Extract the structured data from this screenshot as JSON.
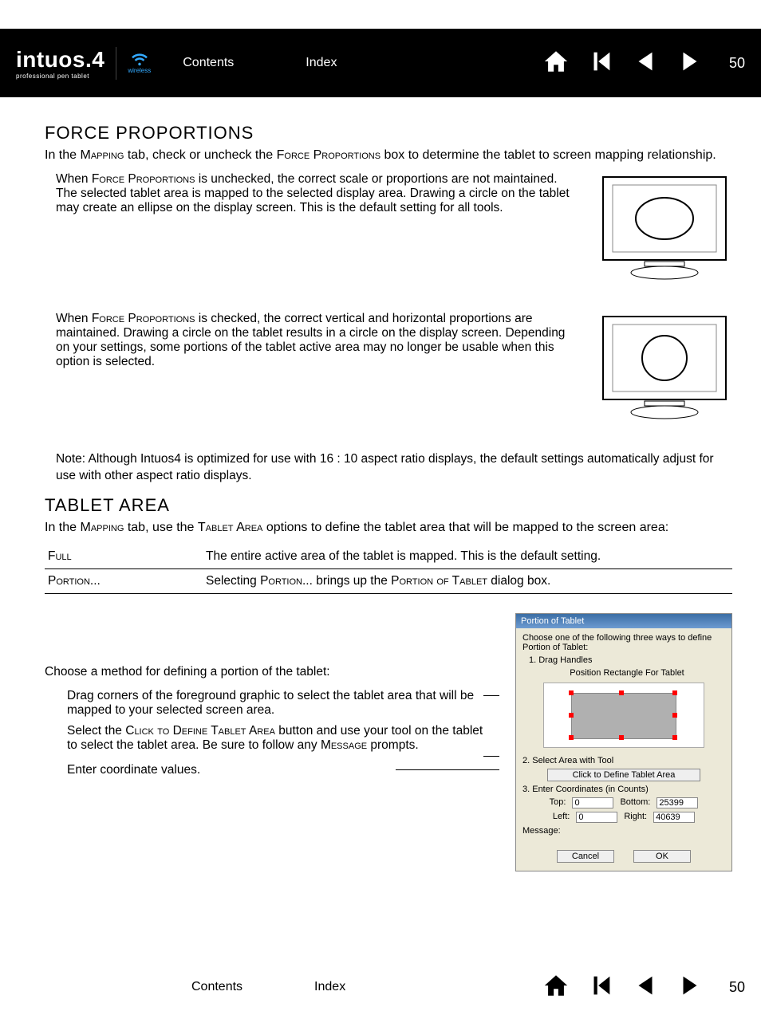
{
  "header": {
    "logo_main": "intuos.4",
    "logo_sub": "professional pen tablet",
    "wireless": "wireless",
    "contents": "Contents",
    "index": "Index",
    "page_number": "50"
  },
  "section1": {
    "title": "FORCE PROPORTIONS",
    "intro_pre": "In the ",
    "intro_sc1": "Mapping",
    "intro_mid": " tab, check or uncheck the ",
    "intro_sc2": "Force Proportions",
    "intro_end": " box to determine the tablet to screen mapping relationship.",
    "p1_pre": "When ",
    "p1_sc": "Force Proportions",
    "p1_end": " is unchecked, the correct scale or proportions are not maintained.  The selected tablet area is mapped to the selected display area.  Drawing a circle on the tablet may create an ellipse on the display screen.  This is the default setting for all tools.",
    "p2_pre": "When ",
    "p2_sc": "Force Proportions",
    "p2_end": " is checked, the correct vertical and horizontal proportions are maintained.  Drawing a circle on the tablet results in a circle on the display screen.  Depending on your settings, some portions of the tablet active area may no longer be usable when this option is selected.",
    "note": "Note:  Although Intuos4 is optimized for use with 16 : 10 aspect ratio displays, the default settings automatically adjust for use with other aspect ratio displays."
  },
  "section2": {
    "title": "TABLET AREA",
    "intro_pre": "In the ",
    "intro_sc1": "Mapping",
    "intro_mid": " tab, use the ",
    "intro_sc2": "Tablet Area",
    "intro_end": " options to define the tablet area that will be mapped to the screen area:",
    "row1_label": "Full",
    "row1_text": "The entire active area of the tablet is mapped.   This is the default setting.",
    "row2_label": "Portion...",
    "row2_pre": "Selecting ",
    "row2_sc1": "Portion...",
    "row2_mid": " brings up the ",
    "row2_sc2": "Portion of Tablet",
    "row2_end": " dialog box.",
    "instr_intro": "Choose a method for defining a portion of the tablet:",
    "instr_b1": "Drag corners of the foreground graphic to select the tablet area that will be mapped to your selected screen area.",
    "instr_b2_pre": "Select the ",
    "instr_b2_sc": "Click to Define Tablet Area",
    "instr_b2_mid": " button and use your tool on the tablet to select the tablet area.  Be sure to follow any ",
    "instr_b2_sc2": "Message",
    "instr_b2_end": " prompts.",
    "instr_b3": "Enter coordinate values."
  },
  "dialog": {
    "title": "Portion of Tablet",
    "intro": "Choose one of the following three ways to define Portion of Tablet:",
    "step1": "1. Drag Handles",
    "step1_sub": "Position Rectangle For Tablet",
    "step2": "2. Select Area with Tool",
    "step2_btn": "Click to Define Tablet Area",
    "step3": "3. Enter Coordinates (in Counts)",
    "top_label": "Top:",
    "top_val": "0",
    "bottom_label": "Bottom:",
    "bottom_val": "25399",
    "left_label": "Left:",
    "left_val": "0",
    "right_label": "Right:",
    "right_val": "40639",
    "message": "Message:",
    "cancel": "Cancel",
    "ok": "OK"
  },
  "footer": {
    "contents": "Contents",
    "index": "Index",
    "page_number": "50"
  }
}
